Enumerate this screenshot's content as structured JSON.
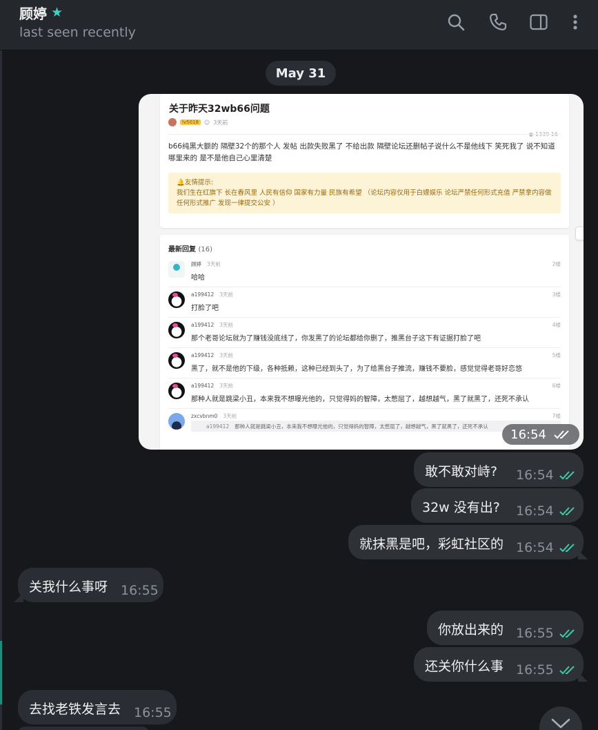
{
  "header": {
    "name": "顾婷",
    "status": "last seen recently",
    "icons": [
      "search-icon",
      "phone-icon",
      "sidebar-toggle-icon",
      "more-vertical-icon"
    ],
    "accent_color": "#35d4c4"
  },
  "date_separator": "May 31",
  "image_message": {
    "time": "16:54",
    "post": {
      "title": "关于昨天32wb66问题",
      "level": "lv5018",
      "ago": "3天前",
      "stats": "1339  16",
      "body": "b66纯黑大额的 隔壁32个的那个人 发帖 出款失败黑了 不给出款 隔壁论坛还删帖子说什么不是他线下 笑死我了 说不知道哪里来的 是不是他自己心里清楚",
      "tip_title": "友情提示:",
      "tip_text": "我们生在红旗下 长在春风里 人民有信仰 国家有力量 民族有希望 （论坛内容仅用于白嫖娱乐 论坛严禁任何形式充值 严禁拿内容做任何形式推广 发现一律提交公安 ）"
    },
    "replies_title": "最新回复",
    "replies_count": "(16)",
    "replies": [
      {
        "user": "顾婷",
        "ago": "3天前",
        "floor": "2楼",
        "text": "哈哈"
      },
      {
        "user": "a199412",
        "ago": "3天前",
        "floor": "3楼",
        "text": "打脸了吧"
      },
      {
        "user": "a199412",
        "ago": "3天前",
        "floor": "4楼",
        "text": "那个老哥论坛就为了赚钱没底线了，你发黑了的论坛都给你删了，推黑台子这下有证据打脸了吧"
      },
      {
        "user": "a199412",
        "ago": "3天前",
        "floor": "5楼",
        "text": "黑了，就不是他的下级，各种抵赖，这种已经到头了，为了给黑台子推流，赚钱不要脸，感觉觉得老哥好恋悠"
      },
      {
        "user": "a199412",
        "ago": "3天前",
        "floor": "6楼",
        "text": "那种人就是跳梁小丑，本来我不想曝光他的，只觉得妈的智障，太憋屈了，越想越气，黑了就黑了，还死不承认"
      },
      {
        "user": "zxcvbnm0",
        "ago": "3天前",
        "floor": "7楼",
        "quote_user": "a199412",
        "quote": "那种人就是跳梁小丑，本来我不想曝光他的，只觉得妈的智障，太憋屈了，越想越气，黑了就黑了，还死不承认"
      }
    ]
  },
  "messages": [
    {
      "dir": "out",
      "text": "敢不敢对峙?",
      "time": "16:54"
    },
    {
      "dir": "out",
      "text": "32w 没有出?",
      "time": "16:54"
    },
    {
      "dir": "out",
      "text": "就抹黑是吧，彩虹社区的",
      "time": "16:54"
    },
    {
      "dir": "in",
      "text": "关我什么事呀",
      "time": "16:55"
    },
    {
      "dir": "out",
      "text": "你放出来的",
      "time": "16:55"
    },
    {
      "dir": "out",
      "text": "还关你什么事",
      "time": "16:55"
    },
    {
      "dir": "in",
      "text": "去找老铁发言去",
      "time": "16:55"
    }
  ],
  "read_tick_color": "#3fc9a8"
}
